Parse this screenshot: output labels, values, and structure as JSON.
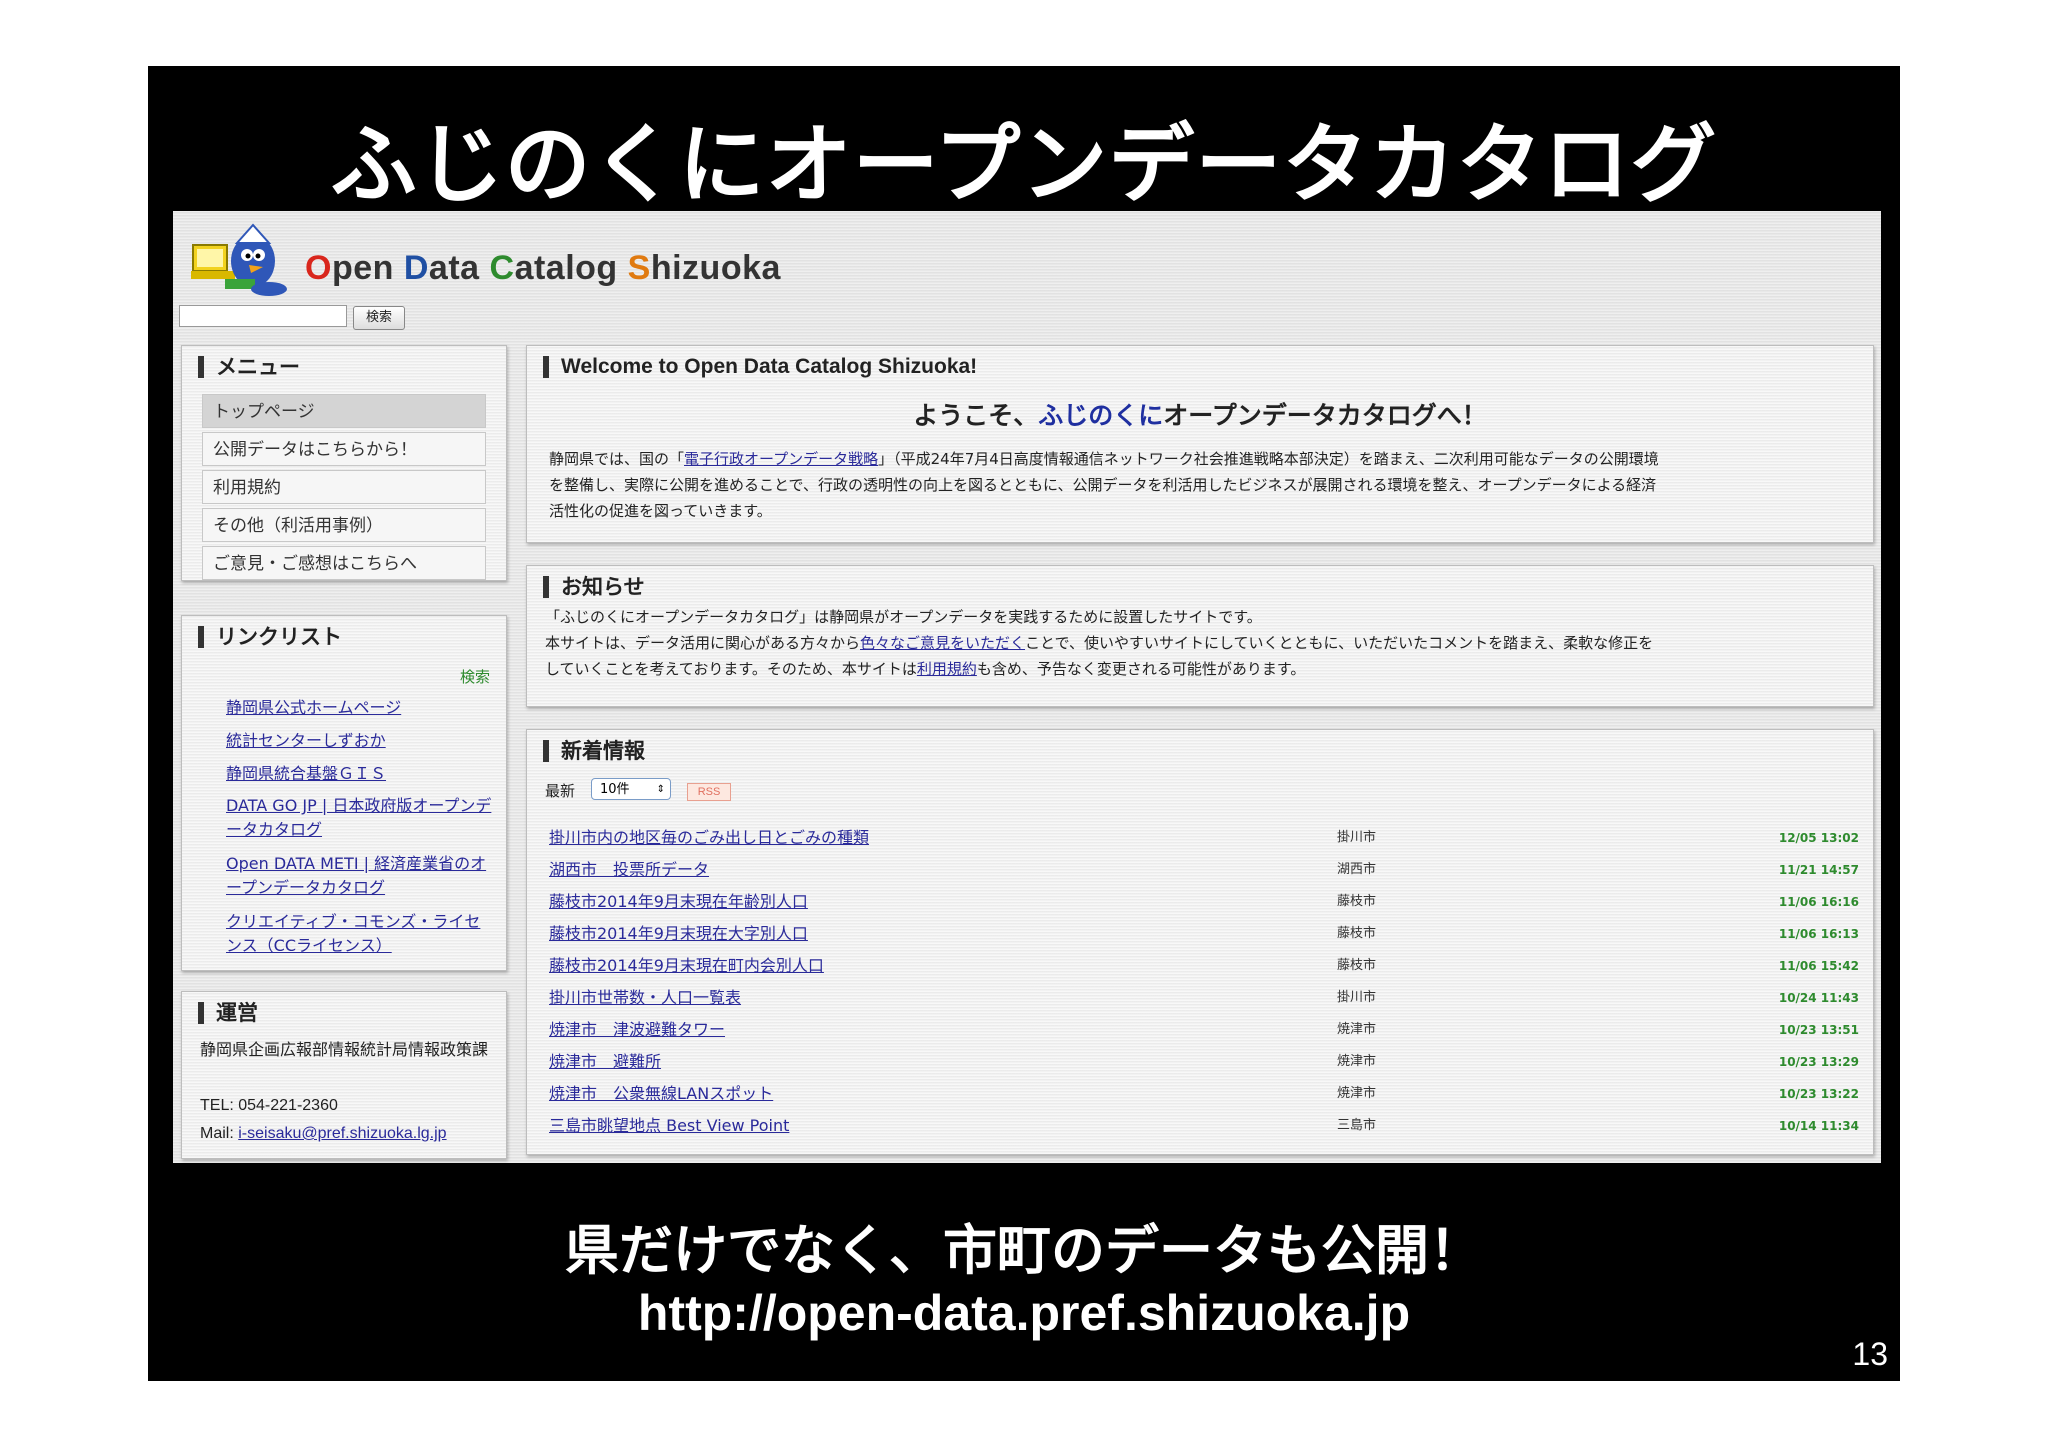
{
  "slide": {
    "title": "ふじのくにオープンデータカタログ",
    "subtitle": "県だけでなく、市町のデータも公開！",
    "url": "http://open-data.pref.shizuoka.jp",
    "page_number": "13"
  },
  "site": {
    "title_parts": [
      "O",
      "pen ",
      "D",
      "ata ",
      "C",
      "atalog ",
      "S",
      "hizuoka"
    ],
    "search_button": "検索"
  },
  "menu": {
    "heading": "メニュー",
    "items": [
      "トップページ",
      "公開データはこちらから！",
      "利用規約",
      "その他（利活用事例）",
      "ご意見・ご感想はこちらへ"
    ]
  },
  "links": {
    "heading": "リンクリスト",
    "search_label": "検索",
    "items": [
      "静岡県公式ホームページ",
      "統計センターしずおか",
      "静岡県統合基盤ＧＩＳ",
      "DATA GO JP | 日本政府版オープンデータカタログ",
      "Open DATA METI | 経済産業省のオープンデータカタログ",
      "クリエイティブ・コモンズ・ライセンス（CCライセンス）"
    ]
  },
  "operation": {
    "heading": "運営",
    "org": "静岡県企画広報部情報統計局情報政策課",
    "tel": "TEL: 054-221-2360",
    "mail_label": "Mail: ",
    "mail": "i-seisaku@pref.shizuoka.lg.jp"
  },
  "welcome": {
    "heading": "Welcome to Open Data Catalog Shizuoka!",
    "big_pre": "ようこそ、",
    "big_blue": "ふじのくに",
    "big_post": "オープンデータカタログへ！",
    "p1_a": "静岡県では、国の「",
    "p1_link": "電子行政オープンデータ戦略",
    "p1_b": "」（平成24年7月4日高度情報通信ネットワーク社会推進戦略本部決定）を踏まえ、二次利用可能なデータの公開環境",
    "p2": "を整備し、実際に公開を進めることで、行政の透明性の向上を図るとともに、公開データを利活用したビジネスが展開される環境を整え、オープンデータによる経済",
    "p3": "活性化の促進を図っていきます。"
  },
  "notice": {
    "heading": "お知らせ",
    "l1": "「ふじのくにオープンデータカタログ」は静岡県がオープンデータを実践するために設置したサイトです。",
    "l2_a": "本サイトは、データ活用に関心がある方々から",
    "l2_link": "色々なご意見をいただく",
    "l2_b": "ことで、使いやすいサイトにしていくとともに、いただいたコメントを踏まえ、柔軟な修正を",
    "l3_a": "していくことを考えております。そのため、本サイトは",
    "l3_link": "利用規約",
    "l3_b": "も含め、予告なく変更される可能性があります。"
  },
  "news": {
    "heading": "新着情報",
    "latest_label": "最新",
    "count_value": "10件",
    "rss_label": "RSS",
    "items": [
      {
        "title": "掛川市内の地区毎のごみ出し日とごみの種類",
        "city": "掛川市",
        "date": "12/05 13:02"
      },
      {
        "title": "湖西市　投票所データ",
        "city": "湖西市",
        "date": "11/21 14:57"
      },
      {
        "title": "藤枝市2014年9月末現在年齢別人口",
        "city": "藤枝市",
        "date": "11/06 16:16"
      },
      {
        "title": "藤枝市2014年9月末現在大字別人口",
        "city": "藤枝市",
        "date": "11/06 16:13"
      },
      {
        "title": "藤枝市2014年9月末現在町内会別人口",
        "city": "藤枝市",
        "date": "11/06 15:42"
      },
      {
        "title": "掛川市世帯数・人口一覧表",
        "city": "掛川市",
        "date": "10/24 11:43"
      },
      {
        "title": "焼津市　津波避難タワー",
        "city": "焼津市",
        "date": "10/23 13:51"
      },
      {
        "title": "焼津市　避難所",
        "city": "焼津市",
        "date": "10/23 13:29"
      },
      {
        "title": "焼津市　公衆無線LANスポット",
        "city": "焼津市",
        "date": "10/23 13:22"
      },
      {
        "title": "三島市眺望地点 Best View Point",
        "city": "三島市",
        "date": "10/14 11:34"
      }
    ]
  },
  "colors": {
    "link": "#2a2a9a",
    "date": "#2e8b2e",
    "brand_red": "#d9261c",
    "brand_blue": "#1f4fa3",
    "brand_green": "#2e8b2e",
    "brand_orange": "#e07a10"
  }
}
